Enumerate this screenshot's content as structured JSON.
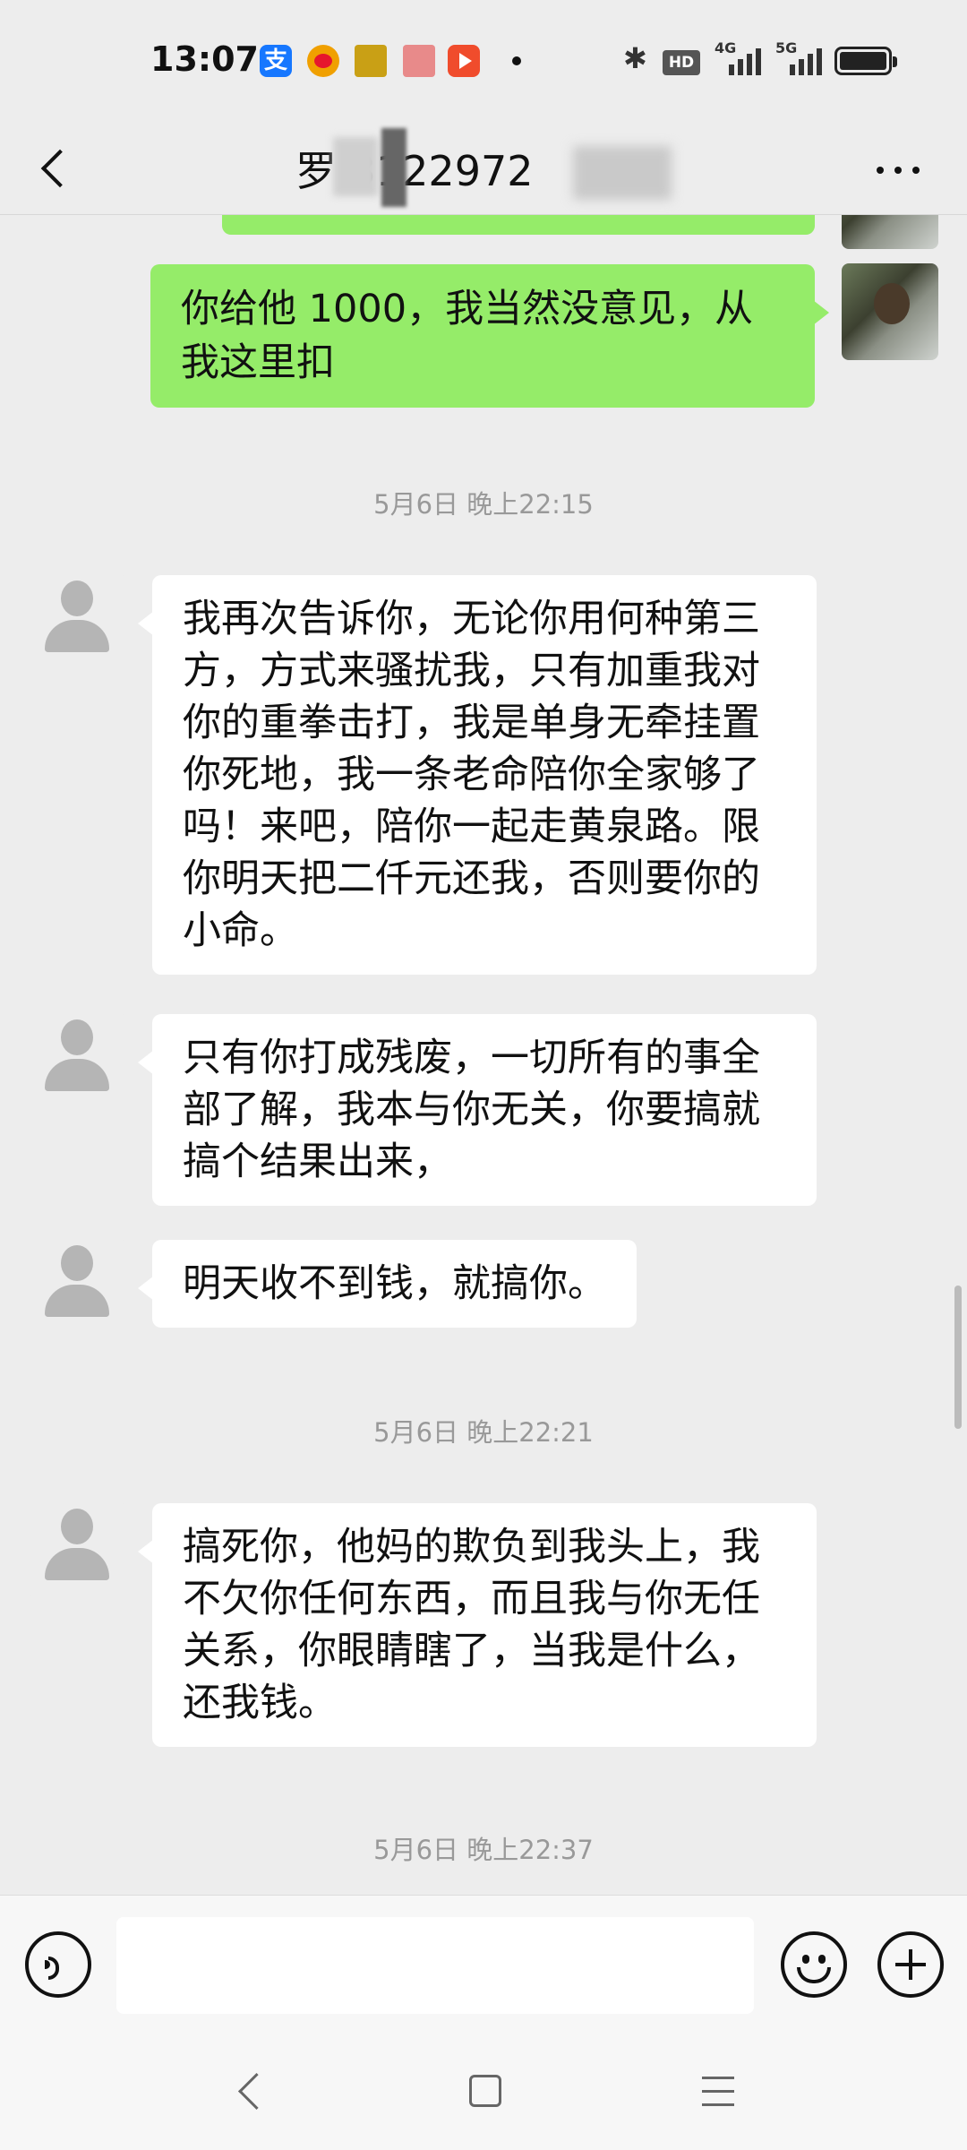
{
  "status_bar": {
    "time": "13:07",
    "alipay_glyph": "支",
    "network_1": "4G",
    "network_2": "5G",
    "hd": "HD",
    "icons": [
      "alipay-icon",
      "weibo-icon",
      "folder-icon",
      "book-icon",
      "video-icon",
      "bluetooth-icon",
      "battery-icon"
    ]
  },
  "header": {
    "title": "罗 3122972"
  },
  "messages": [
    {
      "side": "right",
      "text": "你给他 1000，我当然没意见，从我这里扣"
    },
    {
      "type": "timestamp",
      "text": "5月6日 晚上22:15"
    },
    {
      "side": "left",
      "text": "我再次告诉你，无论你用何种第三方，方式来骚扰我，只有加重我对你的重拳击打，我是单身无牵挂置你死地，我一条老命陪你全家够了吗！来吧，陪你一起走黄泉路。限你明天把二仟元还我，否则要你的小命。"
    },
    {
      "side": "left",
      "text": "只有你打成残废，一切所有的事全部了解，我本与你无关，你要搞就搞个结果出来，"
    },
    {
      "side": "left",
      "text": "明天收不到钱，就搞你。"
    },
    {
      "type": "timestamp",
      "text": "5月6日 晚上22:21"
    },
    {
      "side": "left",
      "text": "搞死你，他妈的欺负到我头上，我不欠你任何东西，而且我与你无任关系，你眼睛瞎了，当我是什么，还我钱。"
    },
    {
      "type": "timestamp",
      "text": "5月6日 晚上22:37"
    }
  ],
  "input": {
    "value": "",
    "placeholder": ""
  },
  "colors": {
    "self_bubble": "#95ec69",
    "other_bubble": "#ffffff",
    "background": "#ededed",
    "timestamp": "#999999"
  }
}
